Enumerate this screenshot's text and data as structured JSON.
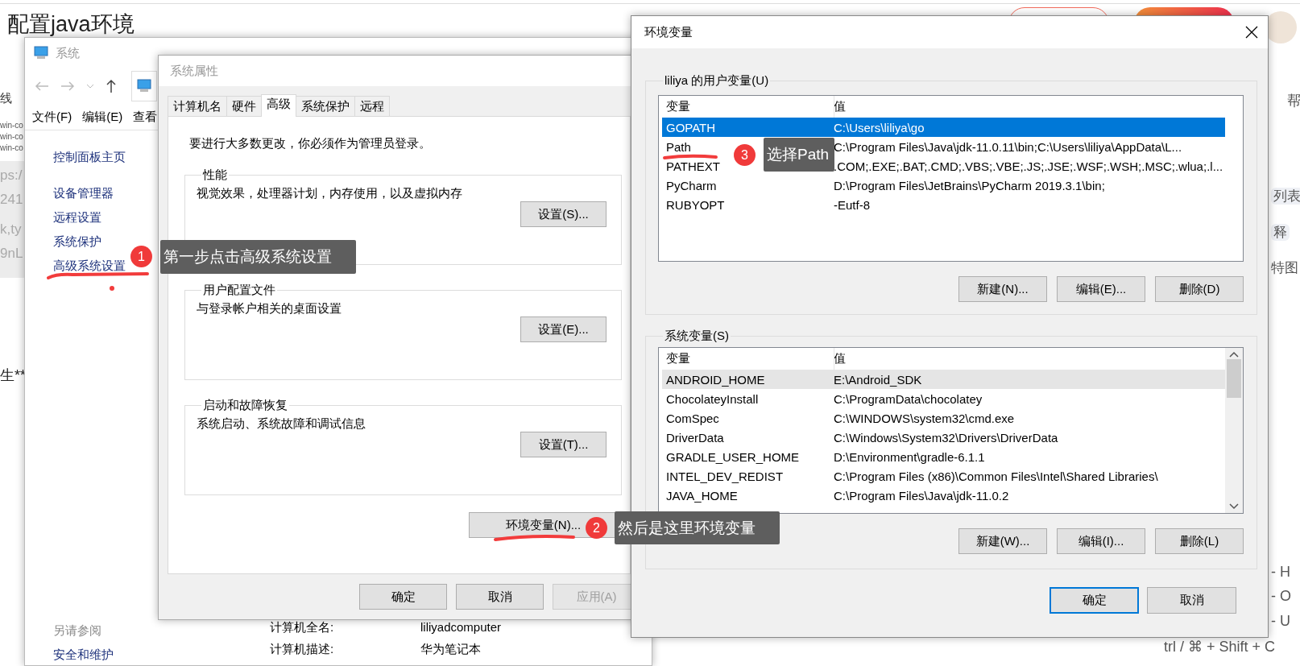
{
  "page": {
    "title": "配置java环境",
    "left_fragments": [
      "线",
      "win-co",
      "win-co",
      "win-co",
      "ps:/",
      "241",
      "k,ty",
      "9nL",
      "生**"
    ],
    "right_fragments": [
      "帮",
      "列表",
      "释",
      "特图",
      "- H",
      "- O",
      "- U",
      "trl / ⌘ + Shift + C"
    ]
  },
  "system_window": {
    "title": "系统",
    "menu": [
      "文件(F)",
      "编辑(E)",
      "查看"
    ],
    "sidebar": [
      "控制面板主页",
      "设备管理器",
      "远程设置",
      "系统保护",
      "高级系统设置"
    ],
    "see_also": {
      "heading": "另请参阅",
      "links": [
        "安全和维护"
      ]
    },
    "details": [
      {
        "label": "计算机全名:",
        "value": "liliyadcomputer"
      },
      {
        "label": "计算机描述:",
        "value": "华为笔记本"
      }
    ]
  },
  "system_properties": {
    "title": "系统属性",
    "tabs": [
      {
        "label": "计算机名",
        "selected": false
      },
      {
        "label": "硬件",
        "selected": false
      },
      {
        "label": "高级",
        "selected": true
      },
      {
        "label": "系统保护",
        "selected": false
      },
      {
        "label": "远程",
        "selected": false
      }
    ],
    "notice": "要进行大多数更改，你必须作为管理员登录。",
    "groups": [
      {
        "title": "性能",
        "description": "视觉效果，处理器计划，内存使用，以及虚拟内存",
        "button": "设置(S)..."
      },
      {
        "title": "用户配置文件",
        "description": "与登录帐户相关的桌面设置",
        "button": "设置(E)..."
      },
      {
        "title": "启动和故障恢复",
        "description": "系统启动、系统故障和调试信息",
        "button": "设置(T)..."
      }
    ],
    "env_button": "环境变量(N)...",
    "buttons": [
      {
        "label": "确定",
        "disabled": false
      },
      {
        "label": "取消",
        "disabled": false
      },
      {
        "label": "应用(A)",
        "disabled": true
      }
    ]
  },
  "environment_variables": {
    "title": "环境变量",
    "user_group": {
      "title": "liliya 的用户变量(U)",
      "columns": [
        "变量",
        "值"
      ],
      "rows": [
        {
          "name": "GOPATH",
          "value": "C:\\Users\\liliya\\go",
          "selected": true
        },
        {
          "name": "Path",
          "value": "C:\\Program Files\\Java\\jdk-11.0.11\\bin;C:\\Users\\liliya\\AppData\\L...",
          "selected": false
        },
        {
          "name": "PATHEXT",
          "value": ".COM;.EXE;.BAT;.CMD;.VBS;.VBE;.JS;.JSE;.WSF;.WSH;.MSC;.wlua;.l...",
          "selected": false
        },
        {
          "name": "PyCharm",
          "value": "D:\\Program Files\\JetBrains\\PyCharm 2019.3.1\\bin;",
          "selected": false
        },
        {
          "name": "RUBYOPT",
          "value": "-Eutf-8",
          "selected": false
        }
      ],
      "buttons": [
        "新建(N)...",
        "编辑(E)...",
        "删除(D)"
      ]
    },
    "system_group": {
      "title": "系统变量(S)",
      "columns": [
        "变量",
        "值"
      ],
      "rows": [
        {
          "name": "ANDROID_HOME",
          "value": "E:\\Android_SDK",
          "selected": false,
          "highlighted": true
        },
        {
          "name": "ChocolateyInstall",
          "value": "C:\\ProgramData\\chocolatey",
          "selected": false,
          "highlighted": false
        },
        {
          "name": "ComSpec",
          "value": "C:\\WINDOWS\\system32\\cmd.exe",
          "selected": false,
          "highlighted": false
        },
        {
          "name": "DriverData",
          "value": "C:\\Windows\\System32\\Drivers\\DriverData",
          "selected": false,
          "highlighted": false
        },
        {
          "name": "GRADLE_USER_HOME",
          "value": "D:\\Environment\\gradle-6.1.1",
          "selected": false,
          "highlighted": false
        },
        {
          "name": "INTEL_DEV_REDIST",
          "value": "C:\\Program Files (x86)\\Common Files\\Intel\\Shared Libraries\\",
          "selected": false,
          "highlighted": false
        },
        {
          "name": "JAVA_HOME",
          "value": "C:\\Program Files\\Java\\jdk-11.0.2",
          "selected": false,
          "highlighted": false
        }
      ],
      "buttons": [
        "新建(W)...",
        "编辑(I)...",
        "删除(L)"
      ]
    },
    "buttons": [
      {
        "label": "确定",
        "default": true
      },
      {
        "label": "取消",
        "default": false
      }
    ]
  },
  "annotations": [
    {
      "number": "1",
      "text": "第一步点击高级系统设置"
    },
    {
      "number": "2",
      "text": "然后是这里环境变量"
    },
    {
      "number": "3",
      "text": "选择Path"
    }
  ]
}
